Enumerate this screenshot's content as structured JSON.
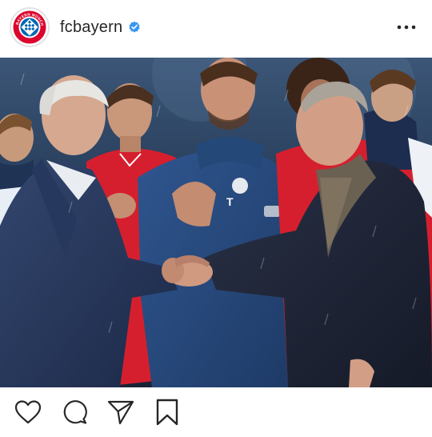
{
  "post": {
    "username": "fcbayern",
    "verified": true,
    "avatar_icon": "fc-bayern-logo-icon",
    "avatar_text": "FC BAYERN MÜNCHEN",
    "more_icon": "more-options-icon",
    "photo_description_icon": "handshake-photo",
    "actions": [
      {
        "icon": "heart-icon"
      },
      {
        "icon": "comment-icon"
      },
      {
        "icon": "share-icon"
      }
    ],
    "save_icon": "bookmark-icon"
  },
  "colors": {
    "bayern_red": "#dc052d",
    "bayern_blue": "#0066b2",
    "verified_blue": "#3897f0",
    "text": "#262626"
  }
}
